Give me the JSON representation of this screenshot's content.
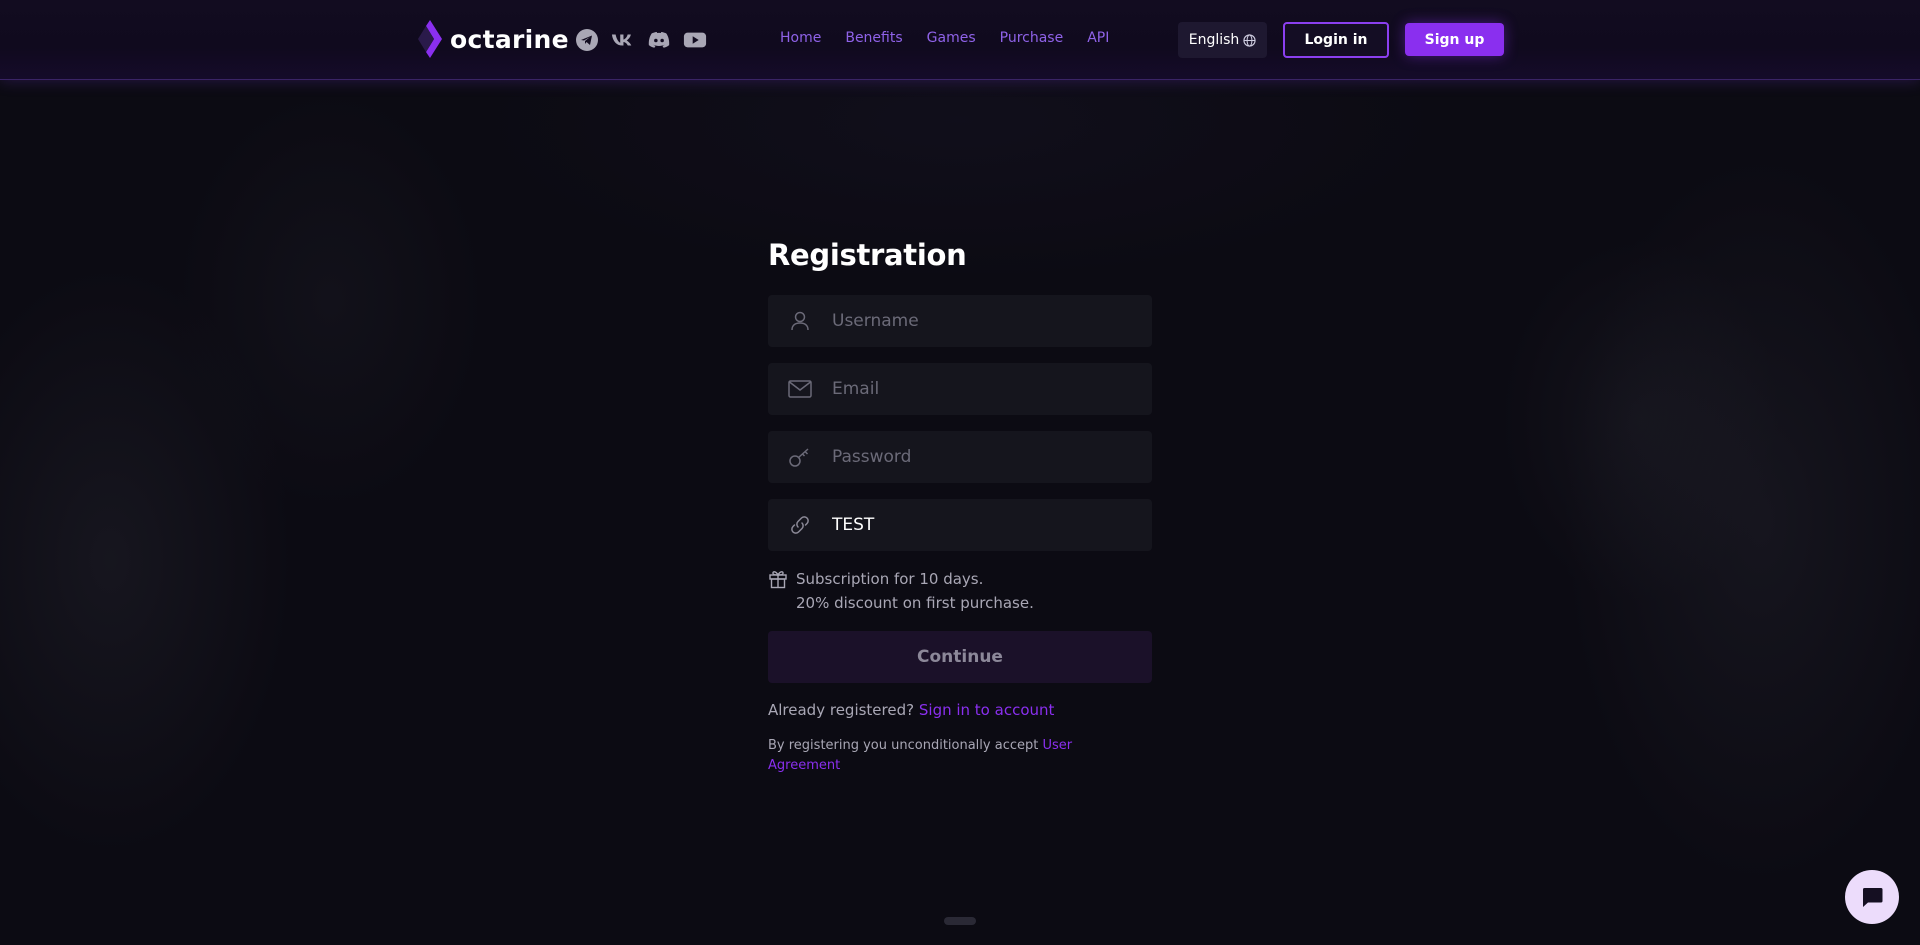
{
  "header": {
    "logo_text": "octarine",
    "socials": [
      "telegram-icon",
      "vk-icon",
      "discord-icon",
      "youtube-icon"
    ],
    "nav": [
      "Home",
      "Benefits",
      "Games",
      "Purchase",
      "API"
    ],
    "language": "English",
    "login_label": "Login in",
    "signup_label": "Sign up"
  },
  "form": {
    "title": "Registration",
    "username": {
      "placeholder": "Username",
      "value": ""
    },
    "email": {
      "placeholder": "Email",
      "value": ""
    },
    "password": {
      "placeholder": "Password",
      "value": ""
    },
    "referral": {
      "placeholder": "",
      "value": "TEST"
    },
    "promo_line1": "Subscription for 10 days.",
    "promo_line2": "20% discount on first purchase.",
    "continue_label": "Continue",
    "already_text": "Already registered?",
    "signin_link": "Sign in to account",
    "terms_text": "By registering you unconditionally accept",
    "terms_link": "User Agreement"
  },
  "colors": {
    "accent": "#8a2fef",
    "background": "#0c0b13",
    "field": "#15151d"
  }
}
